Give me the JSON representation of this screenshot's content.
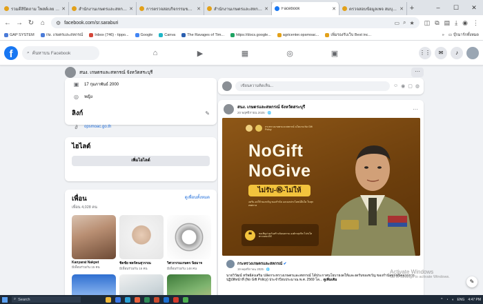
{
  "browser": {
    "tabs": [
      {
        "title": "รวมดีลิปิดถาม โพสต์เลย - Facebook",
        "active": false
      },
      {
        "title": "สำนักงานเกษตรและสหกรณ์",
        "active": false
      },
      {
        "title": "การตรวจสอบกิจกรรมของฉัน",
        "active": false
      },
      {
        "title": "สำนักงานเกษตรและสหกรณ์",
        "active": false
      },
      {
        "title": "Facebook",
        "active": true
      },
      {
        "title": "ตรวจสอบข้อมูลเพจ สมบุรณ์",
        "active": false
      }
    ],
    "new_tab": "+",
    "window_controls": [
      "–",
      "☐",
      "✕"
    ],
    "url": "facebook.com/sr.saraburi",
    "bookmarks": [
      "GAP SYSTEM",
      "กษ. เกษตรและสหกรณ์",
      "Inbox (746) - tippo...",
      "Google",
      "Canva",
      "The Ravages of Tim...",
      "https://docs.google...",
      "agricenter.opsmoac...",
      "เพิ่มรองรับเว็บ Best inc..."
    ],
    "bookmarks_more": "»",
    "bookmarks_folder": "บุ๊กมาร์กทั้งหมด"
  },
  "fb": {
    "logo": "f",
    "search_placeholder": "ค้นหาบน Facebook",
    "page_name": "สนง. เกษตรและสหกรณ์ จังหวัดสระบุรี",
    "page_more": "···"
  },
  "intro": {
    "birthday": "17 กุมภาพันธ์ 2000",
    "gender": "หญิง"
  },
  "links": {
    "title": "ลิงก์",
    "edit_icon": "pencil-icon",
    "url": "opsmoac.go.th"
  },
  "highlights": {
    "title": "ไฮไลต์",
    "button": "เพิ่มไฮไลต์"
  },
  "friends": {
    "title": "เพื่อน",
    "see_all": "ดูเพื่อนทั้งหมด",
    "count": "เพื่อน 4,028 คน",
    "items": [
      {
        "name": "Kanyarat Nakpet",
        "mutual": "มีเพื่อนร่วมกัน 15 คน"
      },
      {
        "name": "ชิดชัย พลรัตนสุวรรณ",
        "mutual": "มีเพื่อนร่วมกัน 16 คน"
      },
      {
        "name": "วิศวกรรมเกษตร นิยมาจ",
        "mutual": "มีเพื่อนร่วมกัน 148 คน"
      }
    ]
  },
  "composer": {
    "placeholder": "เขียนความคิดเห็น..."
  },
  "post": {
    "author": "สนง. เกษตรและสหกรณ์ จังหวัดสระบุรี",
    "date": "20 พฤศจิกายน 2025 · 🌐",
    "more": "···",
    "poster": {
      "org_text": "กระทรวงเกษตรและสหกรณ์\nนโยบาย No Gift Policy",
      "headline1": "NoGift",
      "headline2": "NoGive",
      "pill": "ไม่รับ-㊗-ไม่ให้",
      "sub": "งดรับ-งดให้ ของขวัญ ของกำนัล และผลประโยชน์อื่นใด ในทุกเทศกาล",
      "quote": "ขอเชิญร่วมกันสร้างวัฒนธรรม องค์กรสุจริต โปร่งใส ตรวจสอบได้",
      "quote_mark": "❝"
    },
    "shared_author": "กระทรวงเกษตรและสหกรณ์",
    "shared_verified": "✔",
    "shared_date": "19 พฤศจิกายน 2025 · 🌐",
    "shared_text": "นายวิวัฒน์ ทรัพย์ส่งเสริม ปลัดกระทรวงเกษตรและสหกรณ์ ได้ประกาศนโยบายงดให้และงดรับของขวัญ ของกำนัลทุกชนิดจากการปฏิบัติหน้าที่ (No Gift Policy) ประจำปีงบประมาณ พ.ศ. 2569 โด...",
    "see_more": "ดูเพิ่มเติม"
  },
  "watermark": {
    "title": "Activate Windows",
    "sub": "Go to Settings to activate Windows."
  },
  "taskbar": {
    "search": "Search",
    "tray_lang": "ENG",
    "time": "4:47 PM"
  },
  "colors": {
    "fb_blue": "#1877f2",
    "poster_brown": "#7a4a13",
    "poster_gold": "#f3c43d"
  }
}
